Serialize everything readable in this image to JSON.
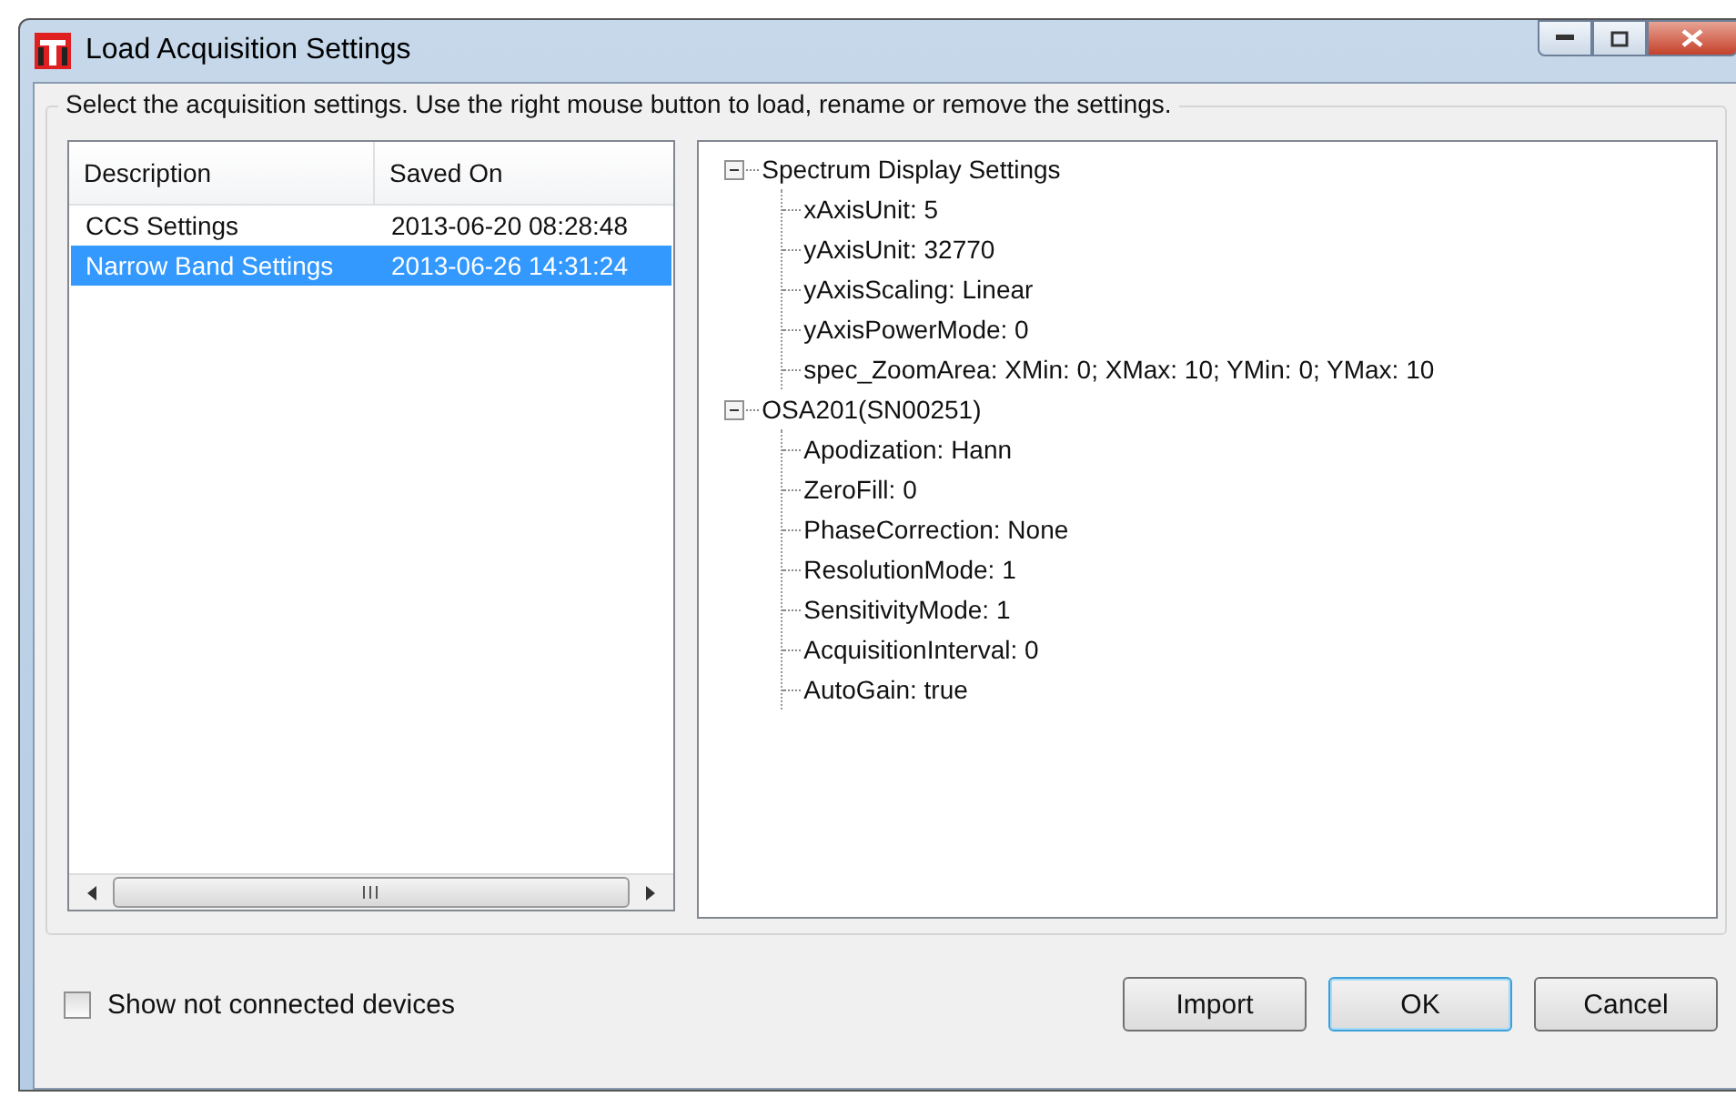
{
  "window": {
    "title": "Load Acquisition Settings"
  },
  "instructions": "Select the acquisition settings. Use the right mouse button to load, rename or remove the settings.",
  "settings_list": {
    "columns": [
      "Description",
      "Saved On"
    ],
    "rows": [
      {
        "cells": [
          "CCS Settings",
          "2013-06-20 08:28:48"
        ],
        "selected": false
      },
      {
        "cells": [
          "Narrow Band Settings",
          "2013-06-26 14:31:24"
        ],
        "selected": true
      }
    ]
  },
  "settings_tree": [
    {
      "label": "Spectrum Display Settings",
      "expanded": true,
      "children": [
        {
          "label": "xAxisUnit:  5"
        },
        {
          "label": "yAxisUnit:  32770"
        },
        {
          "label": "yAxisScaling:  Linear"
        },
        {
          "label": "yAxisPowerMode:  0"
        },
        {
          "label": "spec_ZoomArea:  XMin:  0; XMax:  10; YMin:  0; YMax:  10"
        }
      ]
    },
    {
      "label": "OSA201(SN00251)",
      "expanded": true,
      "children": [
        {
          "label": "Apodization:  Hann"
        },
        {
          "label": "ZeroFill:  0"
        },
        {
          "label": "PhaseCorrection:  None"
        },
        {
          "label": "ResolutionMode:  1"
        },
        {
          "label": "SensitivityMode:  1"
        },
        {
          "label": "AcquisitionInterval:  0"
        },
        {
          "label": "AutoGain:  true"
        }
      ]
    }
  ],
  "show_not_connected": {
    "label": "Show not connected devices",
    "checked": false
  },
  "buttons": [
    {
      "label": "Import",
      "default": false
    },
    {
      "label": "OK",
      "default": true
    },
    {
      "label": "Cancel",
      "default": false
    }
  ]
}
